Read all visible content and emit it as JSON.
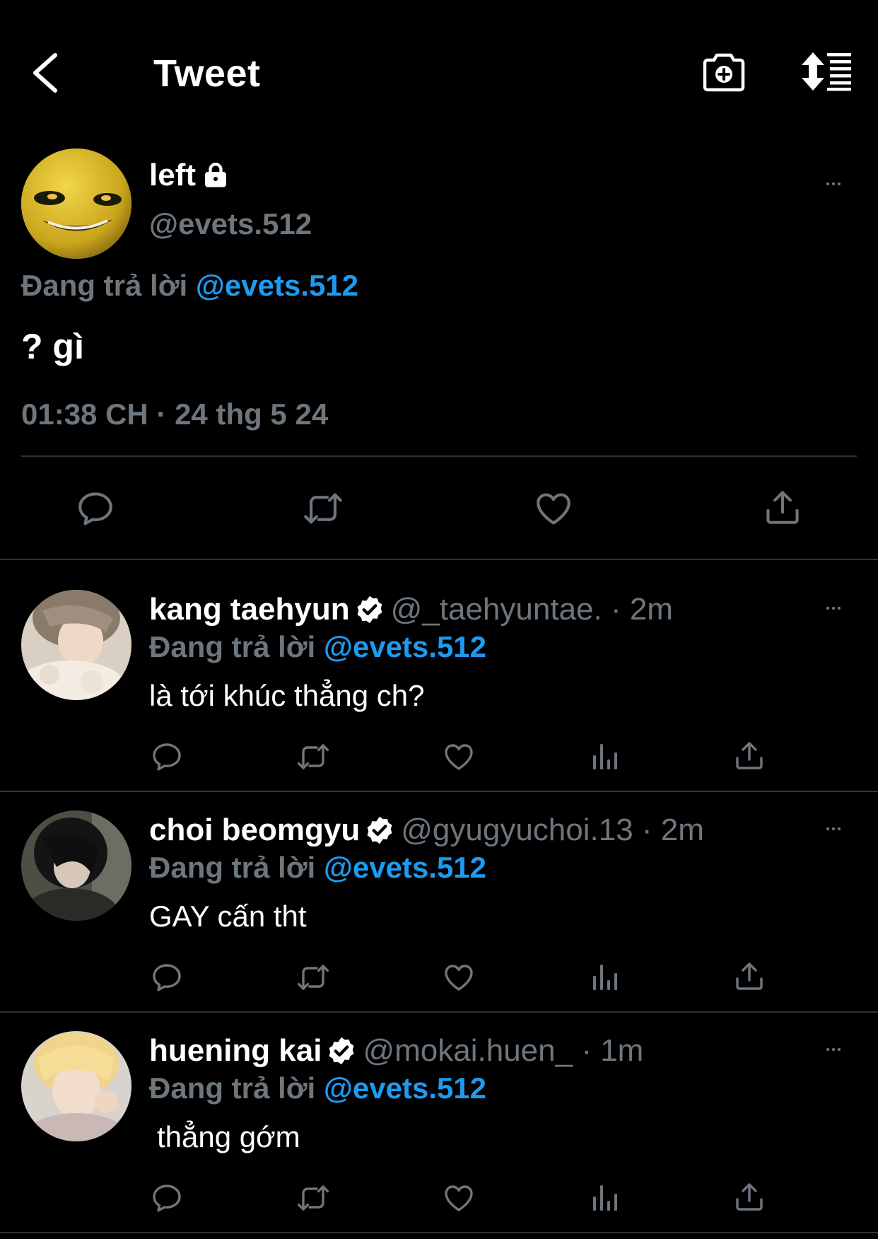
{
  "header": {
    "title": "Tweet",
    "back_icon": "chevron-left-icon",
    "camera_icon": "camera-plus-icon",
    "sort_icon": "sort-list-icon"
  },
  "main_tweet": {
    "name": "left",
    "handle": "@evets.512",
    "replying_prefix": "Đang trả lời",
    "replying_to": "@evets.512",
    "text": "? gì",
    "timestamp": "01:38 CH · 24 thg 5 24",
    "actions": [
      "reply-icon",
      "retweet-icon",
      "like-icon",
      "share-icon"
    ]
  },
  "replies": [
    {
      "name": "kang taehyun",
      "meta": "@_taehyuntae. · 2m",
      "replying_prefix": "Đang trả lời",
      "replying_to": "@evets.512",
      "text": "là tới khúc thẳng ch?"
    },
    {
      "name": "choi beomgyu",
      "meta": "@gyugyuchoi.13 · 2m",
      "replying_prefix": "Đang trả lời",
      "replying_to": "@evets.512",
      "text": "GAY cấn tht"
    },
    {
      "name": "huening kai",
      "meta": "@mokai.huen_ · 1m",
      "replying_prefix": "Đang trả lời",
      "replying_to": "@evets.512",
      "text": "thẳng gớm"
    }
  ],
  "colors": {
    "background": "#000000",
    "text": "#ffffff",
    "muted": "#6e767d",
    "accent": "#1d9bf0",
    "divider": "#2f3336"
  }
}
